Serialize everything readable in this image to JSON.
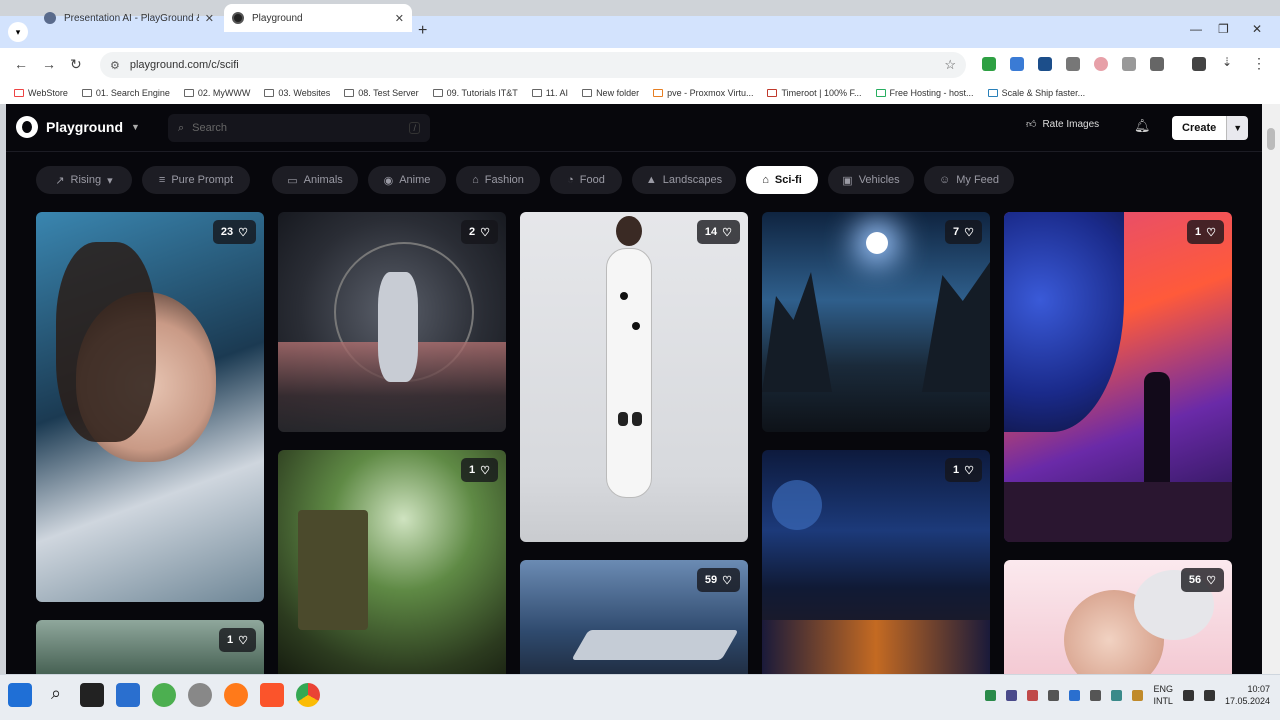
{
  "browser": {
    "tabs": [
      {
        "title": "Presentation AI - PlayGround & ...",
        "active": false
      },
      {
        "title": "Playground",
        "active": true
      }
    ],
    "url": "playground.com/c/scifi",
    "bookmarks": [
      "WebStore",
      "01. Search Engine",
      "02. MyWWW",
      "03. Websites",
      "08. Test Server",
      "09. Tutorials IT&T",
      "11. AI",
      "New folder",
      "pve - Proxmox Virtu...",
      "Timeroot | 100% F...",
      "Free Hosting - host...",
      "Scale & Ship faster..."
    ]
  },
  "site": {
    "brand": "Playground",
    "search_placeholder": "Search",
    "search_shortcut": "/",
    "rate_images": "Rate Images",
    "create": "Create",
    "filters": [
      {
        "label": "Rising",
        "icon": "trending-icon",
        "dropdown": true
      },
      {
        "label": "Pure Prompt",
        "icon": "prompt-icon"
      },
      {
        "label": "Animals",
        "icon": "animal-icon"
      },
      {
        "label": "Anime",
        "icon": "anime-icon"
      },
      {
        "label": "Fashion",
        "icon": "fashion-icon"
      },
      {
        "label": "Food",
        "icon": "food-icon"
      },
      {
        "label": "Landscapes",
        "icon": "landscape-icon"
      },
      {
        "label": "Sci-fi",
        "icon": "rocket-icon",
        "active": true
      },
      {
        "label": "Vehicles",
        "icon": "vehicle-icon"
      },
      {
        "label": "My Feed",
        "icon": "user-icon"
      }
    ],
    "images": [
      {
        "likes": "23",
        "subject": "astronaut girl portrait"
      },
      {
        "likes": "2",
        "subject": "robot in sphere"
      },
      {
        "likes": "14",
        "subject": "white suit figure"
      },
      {
        "likes": "7",
        "subject": "star over canyon"
      },
      {
        "likes": "1",
        "subject": "alien planet silhouette"
      },
      {
        "likes": "1",
        "subject": "jungle ruins"
      },
      {
        "likes": "1",
        "subject": "futuristic city"
      },
      {
        "likes": "1",
        "subject": "misty forest"
      },
      {
        "likes": "59",
        "subject": "spaceship over earth"
      },
      {
        "likes": "56",
        "subject": "floral portrait"
      }
    ]
  },
  "taskbar": {
    "lang": "ENG",
    "region": "INTL",
    "time": "10:07",
    "date": "17.05.2024"
  }
}
